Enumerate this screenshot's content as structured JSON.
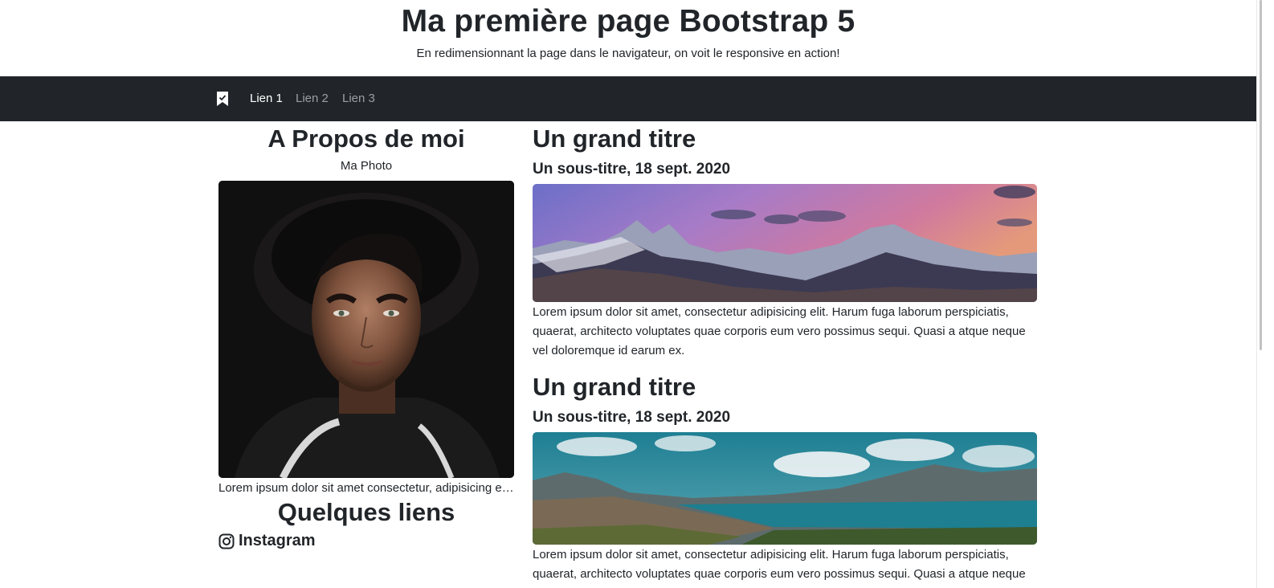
{
  "header": {
    "title": "Ma première page Bootstrap 5",
    "subtitle": "En redimensionnant la page dans le navigateur, on voit le responsive en action!"
  },
  "nav": {
    "brand_icon": "bookmark-check-icon",
    "links": [
      "Lien 1",
      "Lien 2",
      "Lien 3"
    ],
    "active_index": 0
  },
  "about": {
    "title": "A Propos de moi",
    "photo_label": "Ma Photo",
    "caption": "Lorem ipsum dolor sit amet consectetur, adipisicing elit. Eos, voluptatum.",
    "links_title": "Quelques liens",
    "links": [
      {
        "icon": "instagram-icon",
        "label": "Instagram"
      }
    ]
  },
  "posts": [
    {
      "title": "Un grand titre",
      "subtitle": "Un sous-titre, 18 sept. 2020",
      "image": "mountain-sunset-image",
      "text": "Lorem ipsum dolor sit amet, consectetur adipisicing elit. Harum fuga laborum perspiciatis, quaerat, architecto voluptates quae corporis eum vero possimus sequi. Quasi a atque neque vel doloremque id earum ex."
    },
    {
      "title": "Un grand titre",
      "subtitle": "Un sous-titre, 18 sept. 2020",
      "image": "mountain-lake-image",
      "text": "Lorem ipsum dolor sit amet, consectetur adipisicing elit. Harum fuga laborum perspiciatis, quaerat, architecto voluptates quae corporis eum vero possimus sequi. Quasi a atque neque vel doloremque id earum ex."
    }
  ],
  "colors": {
    "navbar": "#212529",
    "text": "#212529",
    "nav_inactive": "rgba(255,255,255,0.55)"
  }
}
